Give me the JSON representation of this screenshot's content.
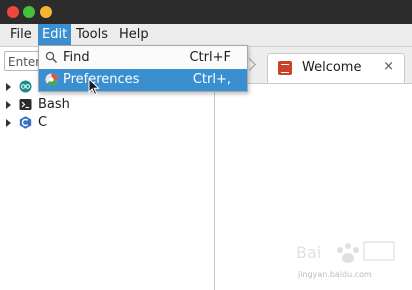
{
  "window": {
    "traffic_lights": [
      "red",
      "green",
      "yellow"
    ]
  },
  "menubar": {
    "items": [
      {
        "label": "File"
      },
      {
        "label": "Edit",
        "active": true
      },
      {
        "label": "Tools"
      },
      {
        "label": "Help"
      }
    ]
  },
  "sidebar": {
    "filter_text": "Enter",
    "tree": [
      {
        "label": "",
        "icon": "arduino-icon"
      },
      {
        "label": "Bash",
        "icon": "terminal-icon"
      },
      {
        "label": "C",
        "icon": "c-language-icon"
      }
    ]
  },
  "tabs": [
    {
      "label": "Welcome",
      "icon": "book-icon",
      "close": "×"
    }
  ],
  "edit_menu": {
    "items": [
      {
        "label": "Find",
        "shortcut": "Ctrl+F",
        "icon": "search-icon"
      },
      {
        "label": "Preferences",
        "shortcut": "Ctrl+,",
        "icon": "preferences-icon",
        "highlighted": true
      }
    ]
  },
  "watermark": {
    "text": "jingyan.baidu.com"
  },
  "colors": {
    "accent": "#3a8fd0",
    "titlebar": "#2c2c2c",
    "menubar": "#ececec"
  }
}
